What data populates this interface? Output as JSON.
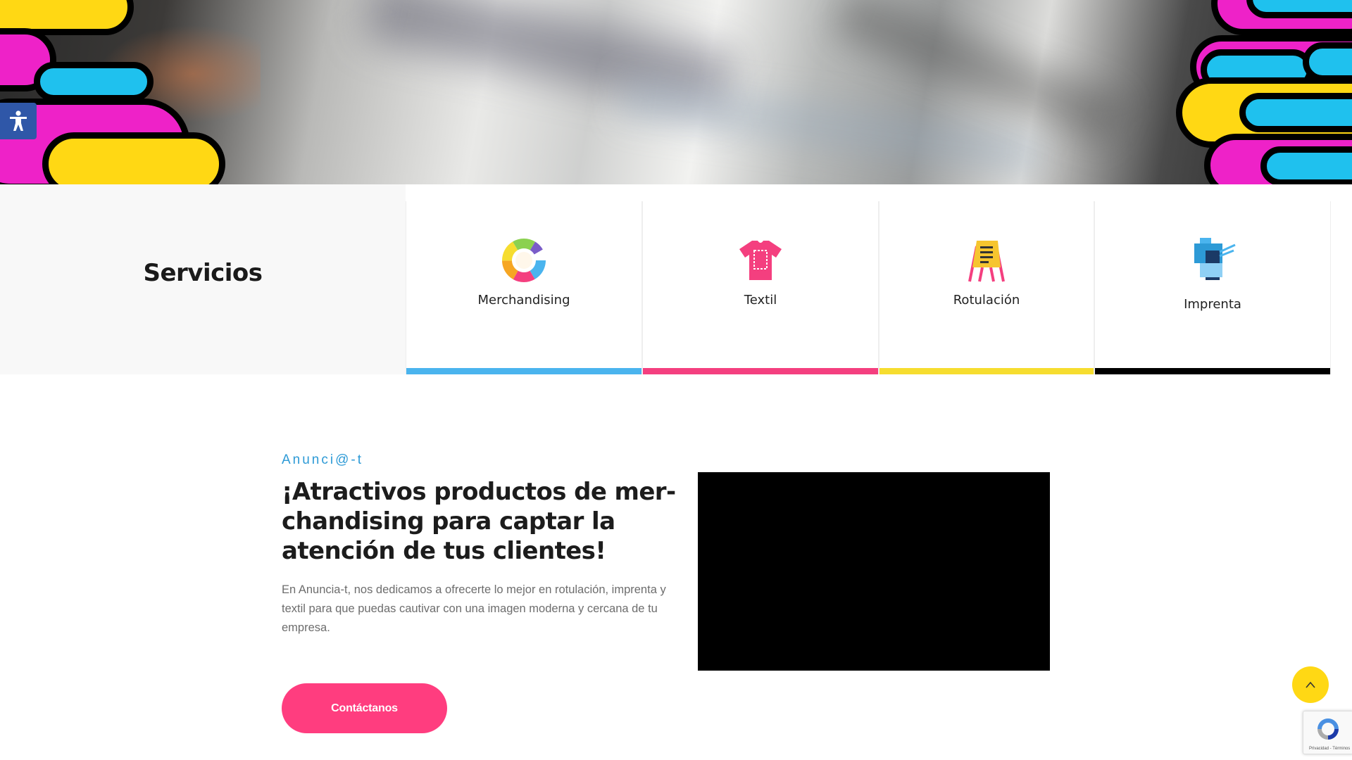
{
  "accessibility": {
    "icon": "accessibility-person-icon"
  },
  "services": {
    "title": "Servicios",
    "items": [
      {
        "label": "Merchandising",
        "icon": "color-wheel-icon",
        "accent": "#4ab4ee"
      },
      {
        "label": "Textil",
        "icon": "tshirt-icon",
        "accent": "#f43f7f"
      },
      {
        "label": "Rotulación",
        "icon": "sign-board-icon",
        "accent": "#f6dd2f"
      },
      {
        "label": "Imprenta",
        "icon": "printer-icon",
        "accent": "#000000"
      }
    ]
  },
  "intro": {
    "eyebrow": "Anunci@-t",
    "headline": "¡Atractivos productos de mer-chandising para captar la atención de tus clientes!",
    "body": "En Anuncia-t, nos dedicamos a ofrecerte lo mejor en rotulación, imprenta y textil para que puedas cautivar con una imagen moderna y cercana de tu empresa.",
    "cta_label": "Contáctanos"
  },
  "floating": {
    "scroll_top_icon": "chevron-up-icon",
    "recaptcha_text": "Privacidad - Términos"
  },
  "colors": {
    "magenta": "#ee22c8",
    "cyan": "#1fc1ee",
    "yellow": "#ffd814",
    "pink": "#ff3d7f",
    "blue": "#2d9ad6"
  }
}
